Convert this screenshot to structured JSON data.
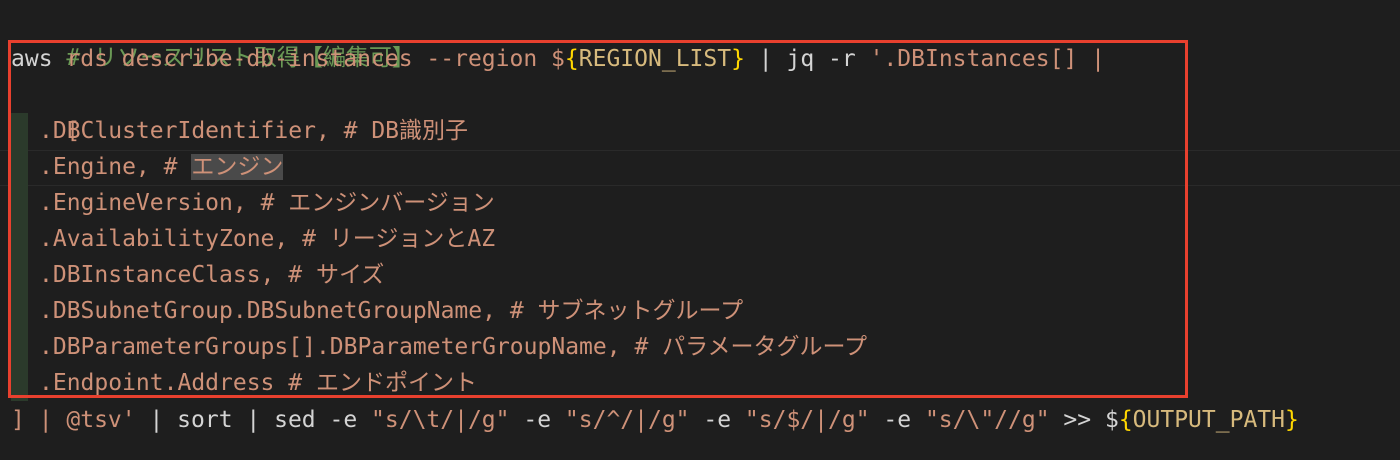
{
  "editor": {
    "heading_comment": "# リソースリスト取得【編集可】",
    "command_line": {
      "cmd": "aws",
      "args": " rds describe-db-instances --region $",
      "brace_open": "{",
      "var": "REGION_LIST",
      "brace_close": "}",
      "pipe_jq": " | jq -r ",
      "jq_start": "'.DBInstances[] |"
    },
    "bracket_open": "[",
    "fields": [
      {
        "path": ".DBClusterIdentifier, ",
        "comment": "# DB識別子"
      },
      {
        "path": ".Engine, ",
        "comment_prefix": "# ",
        "comment_highlighted": "エンジン"
      },
      {
        "path": ".EngineVersion, ",
        "comment": "# エンジンバージョン"
      },
      {
        "path": ".AvailabilityZone, ",
        "comment": "# リージョンとAZ"
      },
      {
        "path": ".DBInstanceClass, ",
        "comment": "# サイズ"
      },
      {
        "path": ".DBSubnetGroup.DBSubnetGroupName, ",
        "comment": "# サブネットグループ"
      },
      {
        "path": ".DBParameterGroups[].DBParameterGroupName, ",
        "comment": "# パラメータグループ"
      },
      {
        "path": ".Endpoint.Address ",
        "comment": "# エンドポイント"
      }
    ],
    "closing_line": {
      "bracket_close": "] | @tsv'",
      "sort": " | sort | sed -e ",
      "sed1": "\"s/\\t/|/g\"",
      "e2": " -e ",
      "sed2": "\"s/^/|/g\"",
      "e3": " -e ",
      "sed3": "\"s/$/|/g\"",
      "e4": " -e ",
      "sed4": "\"s/\\\"//g\"",
      "redirect": " >> $",
      "brace_open": "{",
      "var": "OUTPUT_PATH",
      "brace_close": "}"
    }
  },
  "colors": {
    "background": "#1e1e1e",
    "comment": "#6a9955",
    "string": "#ce9178",
    "brace": "#ffd700",
    "annotation_box": "#e8402e"
  }
}
